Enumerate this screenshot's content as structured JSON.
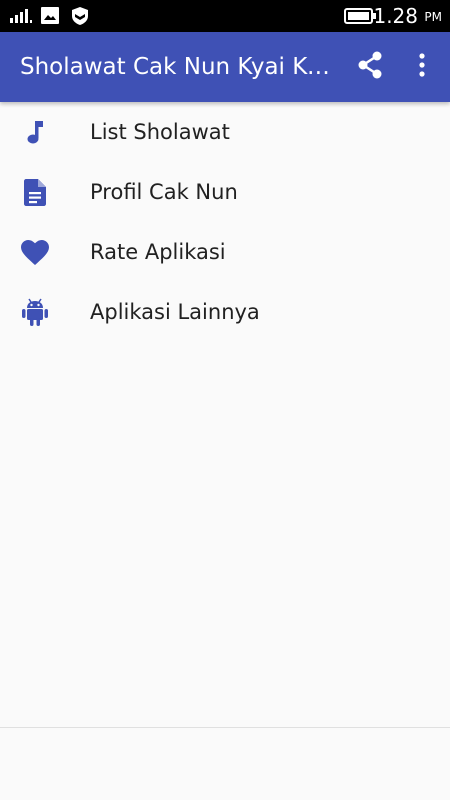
{
  "status_bar": {
    "time": "1.28",
    "ampm": "PM",
    "icons": [
      "signal-icon",
      "image-notification-icon",
      "shield-notification-icon",
      "battery-icon"
    ]
  },
  "app_bar": {
    "title": "Sholawat Cak Nun Kyai Kanjeng",
    "actions": [
      "share-icon",
      "overflow-menu-icon"
    ]
  },
  "menu": {
    "items": [
      {
        "label": "List Sholawat",
        "icon": "music-note-icon"
      },
      {
        "label": "Profil Cak Nun",
        "icon": "document-icon"
      },
      {
        "label": "Rate Aplikasi",
        "icon": "heart-icon"
      },
      {
        "label": "Aplikasi Lainnya",
        "icon": "android-icon"
      }
    ]
  },
  "colors": {
    "primary": "#3f51b5",
    "icon": "#3f51b5",
    "background": "#fafafa",
    "text": "#212121",
    "status_bar": "#000000"
  }
}
